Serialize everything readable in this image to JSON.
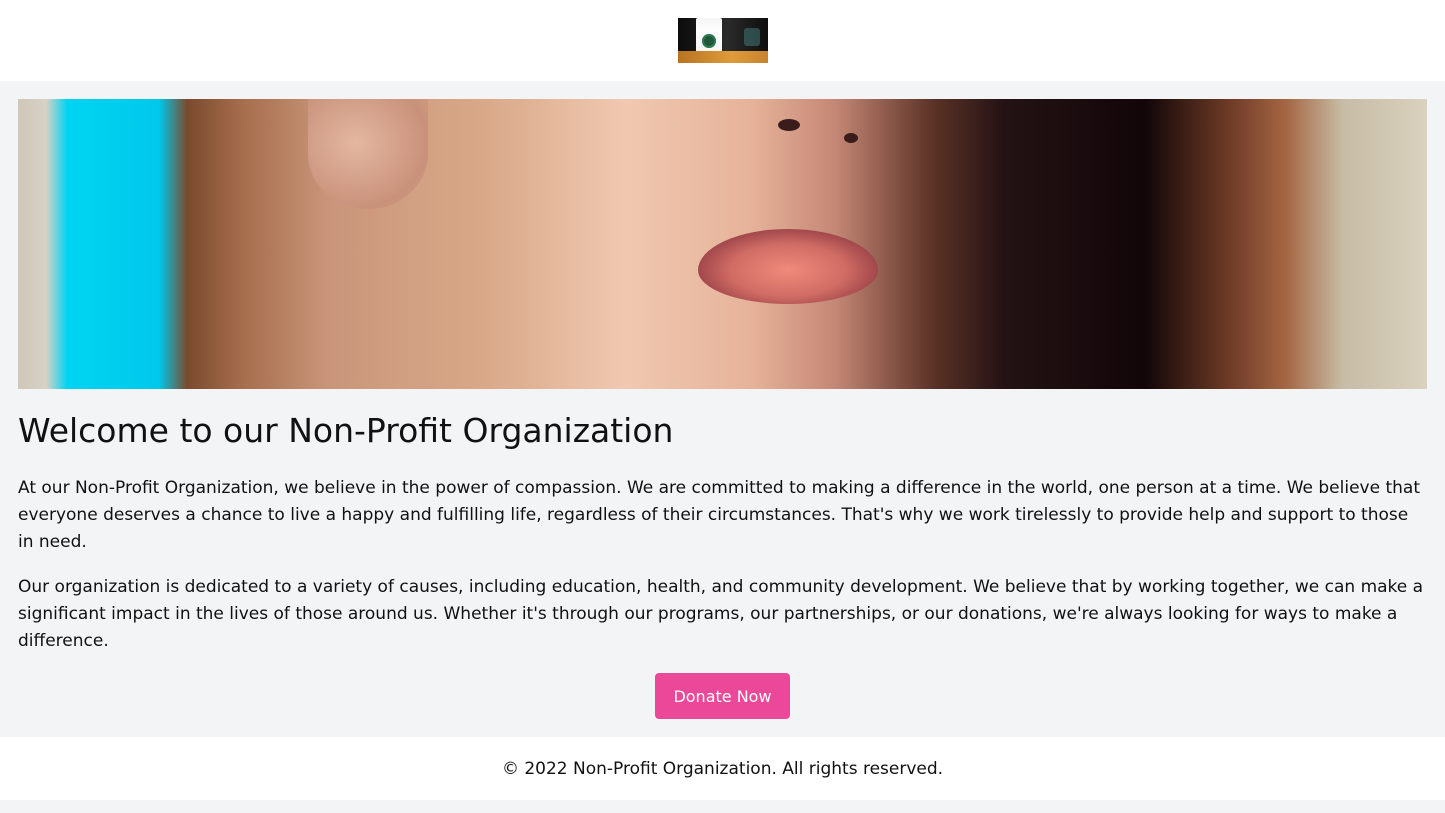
{
  "header": {
    "logo_icon": "coffee-cup-logo"
  },
  "main": {
    "hero_icon": "hero-portrait-image",
    "title": "Welcome to our Non-Profit Organization",
    "paragraphs": [
      "At our Non-Profit Organization, we believe in the power of compassion. We are committed to making a difference in the world, one person at a time. We believe that everyone deserves a chance to live a happy and fulfilling life, regardless of their circumstances. That's why we work tirelessly to provide help and support to those in need.",
      "Our organization is dedicated to a variety of causes, including education, health, and community development. We believe that by working together, we can make a significant impact in the lives of those around us. Whether it's through our programs, our partnerships, or our donations, we're always looking for ways to make a difference."
    ],
    "donate_label": "Donate Now"
  },
  "footer": {
    "text": "© 2022 Non-Profit Organization. All rights reserved."
  },
  "colors": {
    "page_background": "#f3f4f6",
    "surface": "#ffffff",
    "accent": "#ec4899",
    "text": "#111111"
  }
}
